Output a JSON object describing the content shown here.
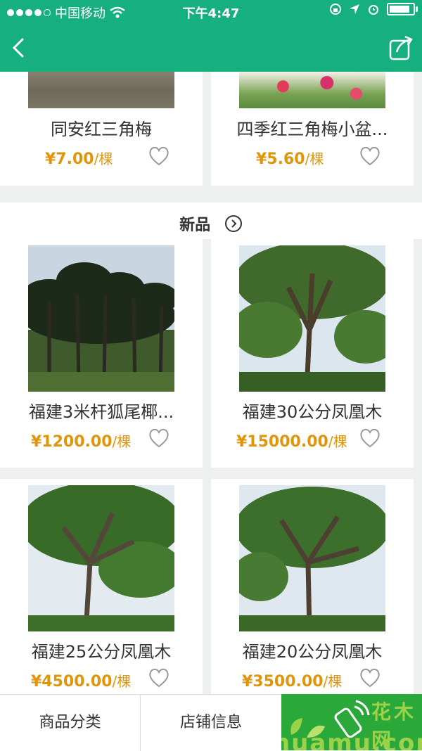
{
  "status": {
    "carrier": "中国移动",
    "time": "下午4:47"
  },
  "products_top": [
    {
      "name": "同安红三角梅",
      "price": "¥7.00",
      "unit": "/棵"
    },
    {
      "name": "四季红三角梅小盆...",
      "price": "¥5.60",
      "unit": "/棵"
    }
  ],
  "section": {
    "title": "新品"
  },
  "products": [
    {
      "name": "福建3米杆狐尾椰...",
      "price": "¥1200.00",
      "unit": "/棵"
    },
    {
      "name": "福建30公分凤凰木",
      "price": "¥15000.00",
      "unit": "/棵"
    },
    {
      "name": "福建25公分凤凰木",
      "price": "¥4500.00",
      "unit": "/棵"
    },
    {
      "name": "福建20公分凤凰木",
      "price": "¥3500.00",
      "unit": "/棵"
    }
  ],
  "tabs": {
    "categories": "商品分类",
    "store_info": "店铺信息"
  },
  "watermark": {
    "brand": "花木网",
    "domain": "huamu.com"
  },
  "colors": {
    "brand_green": "#15b07e",
    "price_orange": "#e0950a"
  }
}
